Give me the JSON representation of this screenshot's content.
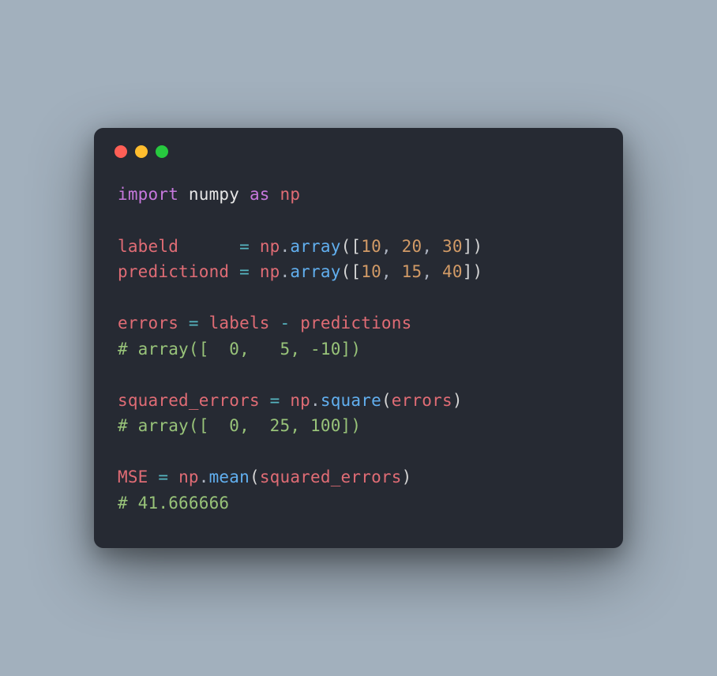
{
  "titlebar": {
    "close_icon": "close-dot",
    "minimize_icon": "minimize-dot",
    "zoom_icon": "zoom-dot"
  },
  "code": {
    "l1": {
      "import": "import",
      "module": "numpy",
      "as": "as",
      "alias": "np"
    },
    "l2": {
      "var": "labeld",
      "eq": "=",
      "np": "np",
      "dot": ".",
      "fn": "array",
      "lp": "(",
      "lb": "[",
      "n1": "10",
      "c1": ",",
      "n2": "20",
      "c2": ",",
      "n3": "30",
      "rb": "]",
      "rp": ")"
    },
    "l3": {
      "var": "predictiond",
      "eq": "=",
      "np": "np",
      "dot": ".",
      "fn": "array",
      "lp": "(",
      "lb": "[",
      "n1": "10",
      "c1": ",",
      "n2": "15",
      "c2": ",",
      "n3": "40",
      "rb": "]",
      "rp": ")"
    },
    "l4": {
      "var": "errors",
      "eq": "=",
      "a": "labels",
      "op": "-",
      "b": "predictions"
    },
    "c4": "# array([  0,   5, -10])",
    "l5": {
      "var": "squared_errors",
      "eq": "=",
      "np": "np",
      "dot": ".",
      "fn": "square",
      "lp": "(",
      "arg": "errors",
      "rp": ")"
    },
    "c5": "# array([  0,  25, 100])",
    "l6": {
      "var": "MSE",
      "eq": "=",
      "np": "np",
      "dot": ".",
      "fn": "mean",
      "lp": "(",
      "arg": "squared_errors",
      "rp": ")"
    },
    "c6": "# 41.666666"
  }
}
